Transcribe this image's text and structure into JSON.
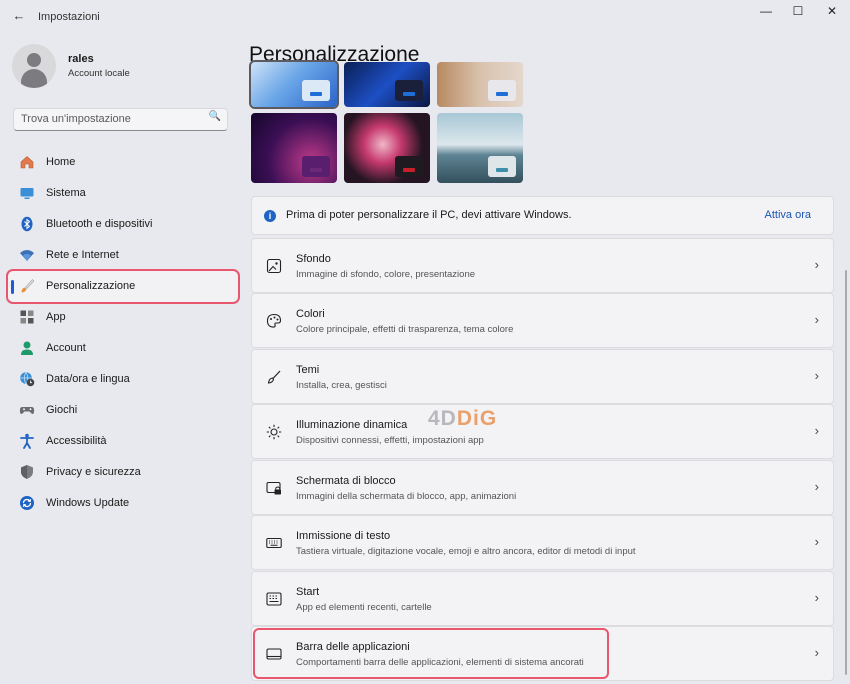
{
  "window": {
    "title": "Impostazioni",
    "back_icon": "back-arrow-icon",
    "controls": [
      "minimize",
      "maximize",
      "close"
    ]
  },
  "profile": {
    "name": "rales",
    "account_type": "Account locale"
  },
  "search": {
    "placeholder": "Trova un'impostazione",
    "icon": "search-icon"
  },
  "nav": {
    "items": [
      {
        "label": "Home",
        "icon": "home-icon"
      },
      {
        "label": "Sistema",
        "icon": "system-icon"
      },
      {
        "label": "Bluetooth e dispositivi",
        "icon": "bluetooth-icon"
      },
      {
        "label": "Rete e Internet",
        "icon": "wifi-icon"
      },
      {
        "label": "Personalizzazione",
        "icon": "paintbrush-icon",
        "selected": true
      },
      {
        "label": "App",
        "icon": "apps-icon"
      },
      {
        "label": "Account",
        "icon": "account-icon"
      },
      {
        "label": "Data/ora e lingua",
        "icon": "globe-clock-icon"
      },
      {
        "label": "Giochi",
        "icon": "gamepad-icon"
      },
      {
        "label": "Accessibilità",
        "icon": "accessibility-icon"
      },
      {
        "label": "Privacy e sicurezza",
        "icon": "shield-icon"
      },
      {
        "label": "Windows Update",
        "icon": "update-icon"
      }
    ]
  },
  "page": {
    "title": "Personalizzazione"
  },
  "wallpapers": [
    {
      "name": "bloom-light-blue",
      "accent": "#1f6fd8"
    },
    {
      "name": "bloom-dark-blue",
      "accent": "#1f6fd8"
    },
    {
      "name": "photo-collage",
      "accent": "#1f6fd8"
    },
    {
      "name": "purple-glow",
      "accent": "#6a2a78"
    },
    {
      "name": "flower-dark",
      "accent": "#c6202a"
    },
    {
      "name": "lake-landscape",
      "accent": "#3b8fa8"
    }
  ],
  "activation": {
    "message": "Prima di poter personalizzare il PC, devi attivare Windows.",
    "action": "Attiva ora",
    "icon": "info-icon"
  },
  "settings": [
    {
      "title": "Sfondo",
      "subtitle": "Immagine di sfondo, colore, presentazione",
      "icon": "image-icon"
    },
    {
      "title": "Colori",
      "subtitle": "Colore principale, effetti di trasparenza, tema colore",
      "icon": "palette-icon"
    },
    {
      "title": "Temi",
      "subtitle": "Installa, crea, gestisci",
      "icon": "brush-icon"
    },
    {
      "title": "Illuminazione dinamica",
      "subtitle": "Dispositivi connessi, effetti, impostazioni app",
      "icon": "sun-icon"
    },
    {
      "title": "Schermata di blocco",
      "subtitle": "Immagini della schermata di blocco, app, animazioni",
      "icon": "lock-screen-icon"
    },
    {
      "title": "Immissione di testo",
      "subtitle": "Tastiera virtuale, digitazione vocale, emoji e altro ancora, editor di metodi di input",
      "icon": "keyboard-icon"
    },
    {
      "title": "Start",
      "subtitle": "App ed elementi recenti, cartelle",
      "icon": "start-icon"
    },
    {
      "title": "Barra delle applicazioni",
      "subtitle": "Comportamenti barra delle applicazioni, elementi di sistema ancorati",
      "icon": "taskbar-icon",
      "highlighted": true
    }
  ],
  "watermark": {
    "part1": "4D",
    "part2": "DiG"
  },
  "colors": {
    "accent": "#1f5bd6",
    "highlight": "#e8576e",
    "link": "#1a55b3"
  }
}
